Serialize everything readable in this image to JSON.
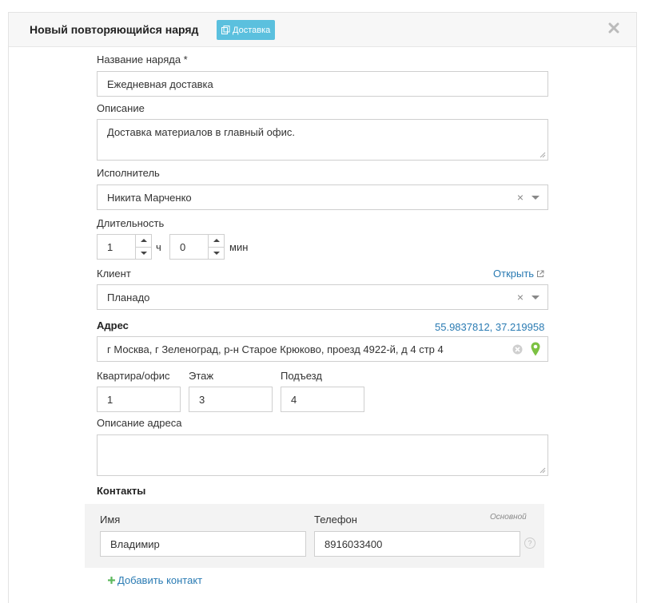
{
  "header": {
    "title": "Новый повторяющийся наряд",
    "badge": "Доставка"
  },
  "form": {
    "name": {
      "label": "Название наряда *",
      "value": "Ежедневная доставка"
    },
    "description": {
      "label": "Описание",
      "value": "Доставка материалов в главный офис."
    },
    "executor": {
      "label": "Исполнитель",
      "value": "Никита Марченко",
      "clear": "×"
    },
    "duration": {
      "label": "Длительность",
      "hours": "1",
      "hours_unit": "ч",
      "minutes": "0",
      "minutes_unit": "мин"
    },
    "client": {
      "label": "Клиент",
      "open_link": "Открыть",
      "value": "Планадо",
      "clear": "×"
    },
    "address": {
      "label": "Адрес",
      "coords": "55.9837812, 37.219958",
      "value": "г Москва, г Зеленоград, р-н Старое Крюково, проезд 4922-й, д 4 стр 4"
    },
    "apartment": {
      "label": "Квартира/офис",
      "value": "1"
    },
    "floor": {
      "label": "Этаж",
      "value": "3"
    },
    "entrance": {
      "label": "Подъезд",
      "value": "4"
    },
    "address_description": {
      "label": "Описание адреса",
      "value": ""
    }
  },
  "contacts": {
    "heading": "Контакты",
    "name_label": "Имя",
    "phone_label": "Телефон",
    "primary_hint": "Основной",
    "items": [
      {
        "name": "Владимир",
        "phone": "8916033400"
      }
    ],
    "add_label": "Добавить контакт",
    "help": "?"
  },
  "colors": {
    "badge": "#5bc0de",
    "link": "#2a7bb3",
    "map_pin": "#7cc142",
    "add_plus": "#5cb85c"
  }
}
